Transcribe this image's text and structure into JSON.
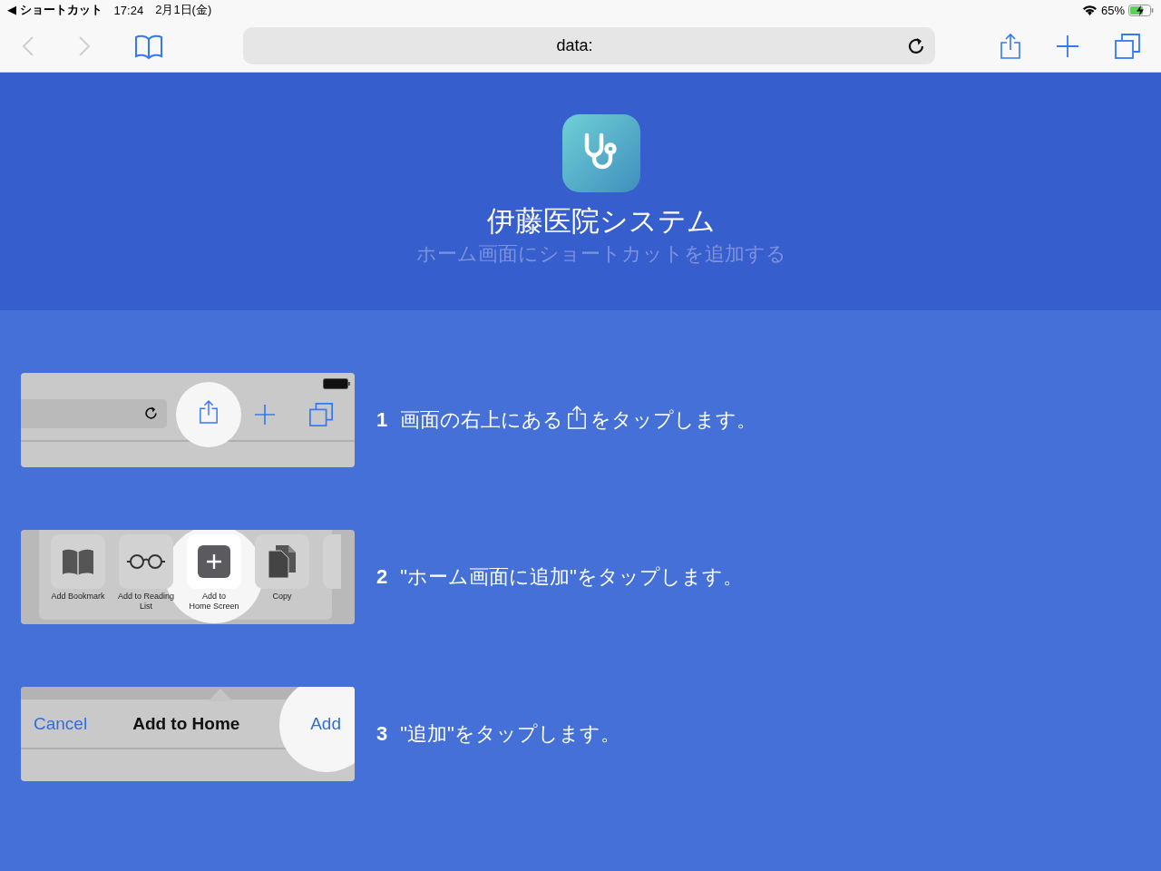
{
  "status_bar": {
    "back_label": "◀ ショートカット",
    "time": "17:24",
    "date": "2月1日(金)",
    "battery_percent": "65%"
  },
  "toolbar": {
    "url": "data:"
  },
  "header": {
    "app_name": "伊藤医院システム",
    "subtitle": "ホーム画面にショートカットを追加する"
  },
  "steps": [
    {
      "kind": "share",
      "number": "1",
      "text_before": "画面の右上にある",
      "text_after": "をタップします。"
    },
    {
      "kind": "actions",
      "number": "2",
      "text": "\"ホーム画面に追加\"をタップします。",
      "actions": [
        {
          "kind": "bookmark",
          "label": "Add Bookmark",
          "selected": false
        },
        {
          "kind": "glasses",
          "label": "Add to Reading\nList",
          "selected": false
        },
        {
          "kind": "plus",
          "label": "Add to\nHome Screen",
          "selected": true
        },
        {
          "kind": "copy",
          "label": "Copy",
          "selected": false
        }
      ]
    },
    {
      "kind": "dialog",
      "number": "3",
      "text": "\"追加\"をタップします。",
      "cancel": "Cancel",
      "title": "Add to Home",
      "add": "Add"
    }
  ]
}
